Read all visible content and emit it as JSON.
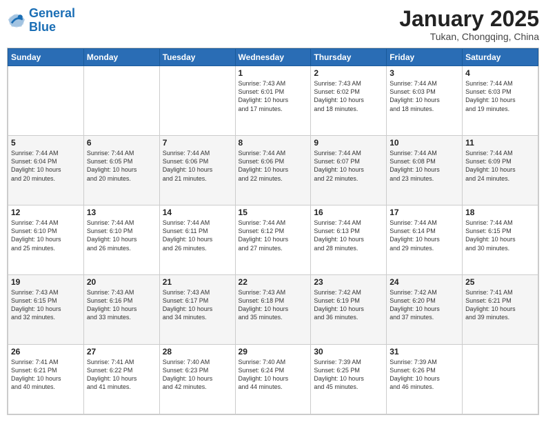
{
  "header": {
    "logo_general": "General",
    "logo_blue": "Blue",
    "month_title": "January 2025",
    "location": "Tukan, Chongqing, China"
  },
  "calendar": {
    "days_of_week": [
      "Sunday",
      "Monday",
      "Tuesday",
      "Wednesday",
      "Thursday",
      "Friday",
      "Saturday"
    ],
    "weeks": [
      [
        {
          "day": "",
          "info": ""
        },
        {
          "day": "",
          "info": ""
        },
        {
          "day": "",
          "info": ""
        },
        {
          "day": "1",
          "info": "Sunrise: 7:43 AM\nSunset: 6:01 PM\nDaylight: 10 hours\nand 17 minutes."
        },
        {
          "day": "2",
          "info": "Sunrise: 7:43 AM\nSunset: 6:02 PM\nDaylight: 10 hours\nand 18 minutes."
        },
        {
          "day": "3",
          "info": "Sunrise: 7:44 AM\nSunset: 6:03 PM\nDaylight: 10 hours\nand 18 minutes."
        },
        {
          "day": "4",
          "info": "Sunrise: 7:44 AM\nSunset: 6:03 PM\nDaylight: 10 hours\nand 19 minutes."
        }
      ],
      [
        {
          "day": "5",
          "info": "Sunrise: 7:44 AM\nSunset: 6:04 PM\nDaylight: 10 hours\nand 20 minutes."
        },
        {
          "day": "6",
          "info": "Sunrise: 7:44 AM\nSunset: 6:05 PM\nDaylight: 10 hours\nand 20 minutes."
        },
        {
          "day": "7",
          "info": "Sunrise: 7:44 AM\nSunset: 6:06 PM\nDaylight: 10 hours\nand 21 minutes."
        },
        {
          "day": "8",
          "info": "Sunrise: 7:44 AM\nSunset: 6:06 PM\nDaylight: 10 hours\nand 22 minutes."
        },
        {
          "day": "9",
          "info": "Sunrise: 7:44 AM\nSunset: 6:07 PM\nDaylight: 10 hours\nand 22 minutes."
        },
        {
          "day": "10",
          "info": "Sunrise: 7:44 AM\nSunset: 6:08 PM\nDaylight: 10 hours\nand 23 minutes."
        },
        {
          "day": "11",
          "info": "Sunrise: 7:44 AM\nSunset: 6:09 PM\nDaylight: 10 hours\nand 24 minutes."
        }
      ],
      [
        {
          "day": "12",
          "info": "Sunrise: 7:44 AM\nSunset: 6:10 PM\nDaylight: 10 hours\nand 25 minutes."
        },
        {
          "day": "13",
          "info": "Sunrise: 7:44 AM\nSunset: 6:10 PM\nDaylight: 10 hours\nand 26 minutes."
        },
        {
          "day": "14",
          "info": "Sunrise: 7:44 AM\nSunset: 6:11 PM\nDaylight: 10 hours\nand 26 minutes."
        },
        {
          "day": "15",
          "info": "Sunrise: 7:44 AM\nSunset: 6:12 PM\nDaylight: 10 hours\nand 27 minutes."
        },
        {
          "day": "16",
          "info": "Sunrise: 7:44 AM\nSunset: 6:13 PM\nDaylight: 10 hours\nand 28 minutes."
        },
        {
          "day": "17",
          "info": "Sunrise: 7:44 AM\nSunset: 6:14 PM\nDaylight: 10 hours\nand 29 minutes."
        },
        {
          "day": "18",
          "info": "Sunrise: 7:44 AM\nSunset: 6:15 PM\nDaylight: 10 hours\nand 30 minutes."
        }
      ],
      [
        {
          "day": "19",
          "info": "Sunrise: 7:43 AM\nSunset: 6:15 PM\nDaylight: 10 hours\nand 32 minutes."
        },
        {
          "day": "20",
          "info": "Sunrise: 7:43 AM\nSunset: 6:16 PM\nDaylight: 10 hours\nand 33 minutes."
        },
        {
          "day": "21",
          "info": "Sunrise: 7:43 AM\nSunset: 6:17 PM\nDaylight: 10 hours\nand 34 minutes."
        },
        {
          "day": "22",
          "info": "Sunrise: 7:43 AM\nSunset: 6:18 PM\nDaylight: 10 hours\nand 35 minutes."
        },
        {
          "day": "23",
          "info": "Sunrise: 7:42 AM\nSunset: 6:19 PM\nDaylight: 10 hours\nand 36 minutes."
        },
        {
          "day": "24",
          "info": "Sunrise: 7:42 AM\nSunset: 6:20 PM\nDaylight: 10 hours\nand 37 minutes."
        },
        {
          "day": "25",
          "info": "Sunrise: 7:41 AM\nSunset: 6:21 PM\nDaylight: 10 hours\nand 39 minutes."
        }
      ],
      [
        {
          "day": "26",
          "info": "Sunrise: 7:41 AM\nSunset: 6:21 PM\nDaylight: 10 hours\nand 40 minutes."
        },
        {
          "day": "27",
          "info": "Sunrise: 7:41 AM\nSunset: 6:22 PM\nDaylight: 10 hours\nand 41 minutes."
        },
        {
          "day": "28",
          "info": "Sunrise: 7:40 AM\nSunset: 6:23 PM\nDaylight: 10 hours\nand 42 minutes."
        },
        {
          "day": "29",
          "info": "Sunrise: 7:40 AM\nSunset: 6:24 PM\nDaylight: 10 hours\nand 44 minutes."
        },
        {
          "day": "30",
          "info": "Sunrise: 7:39 AM\nSunset: 6:25 PM\nDaylight: 10 hours\nand 45 minutes."
        },
        {
          "day": "31",
          "info": "Sunrise: 7:39 AM\nSunset: 6:26 PM\nDaylight: 10 hours\nand 46 minutes."
        },
        {
          "day": "",
          "info": ""
        }
      ]
    ]
  }
}
